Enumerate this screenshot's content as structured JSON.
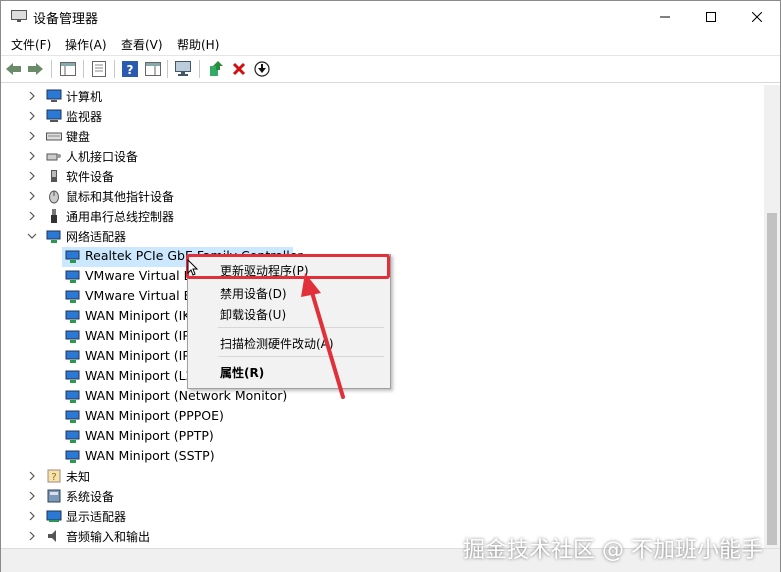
{
  "window": {
    "title": "设备管理器"
  },
  "menu": [
    "文件(F)",
    "操作(A)",
    "查看(V)",
    "帮助(H)"
  ],
  "tree": [
    {
      "label": "计算机",
      "icon": "computer-icon"
    },
    {
      "label": "监视器",
      "icon": "monitor-icon"
    },
    {
      "label": "键盘",
      "icon": "keyboard-icon"
    },
    {
      "label": "人机接口设备",
      "icon": "hid-icon"
    },
    {
      "label": "软件设备",
      "icon": "software-device-icon"
    },
    {
      "label": "鼠标和其他指针设备",
      "icon": "mouse-icon"
    },
    {
      "label": "通用串行总线控制器",
      "icon": "usb-icon"
    },
    {
      "label": "网络适配器",
      "icon": "network-adapter-icon",
      "expanded": true
    },
    {
      "label": "未知",
      "icon": "unknown-device-icon"
    },
    {
      "label": "系统设备",
      "icon": "system-device-icon"
    },
    {
      "label": "显示适配器",
      "icon": "display-adapter-icon"
    },
    {
      "label": "音频输入和输出",
      "icon": "speaker-icon"
    }
  ],
  "network_children": [
    "Realtek PCIe GbE Family Controller",
    "VMware Virtual E",
    "VMware Virtual E",
    "WAN Miniport (IK",
    "WAN Miniport (IP",
    "WAN Miniport (IP",
    "WAN Miniport (L2",
    "WAN Miniport (Network Monitor)",
    "WAN Miniport (PPPOE)",
    "WAN Miniport (PPTP)",
    "WAN Miniport (SSTP)"
  ],
  "context_menu": {
    "update_driver": "更新驱动程序(P)",
    "disable": "禁用设备(D)",
    "uninstall": "卸载设备(U)",
    "scan": "扫描检测硬件改动(A)",
    "properties": "属性(R)"
  },
  "watermark": "掘金技术社区 @ 不加班小能手",
  "colors": {
    "highlight": "#e0303a",
    "selection": "#cce8ff",
    "icon_blue": "#2a7ad5"
  }
}
